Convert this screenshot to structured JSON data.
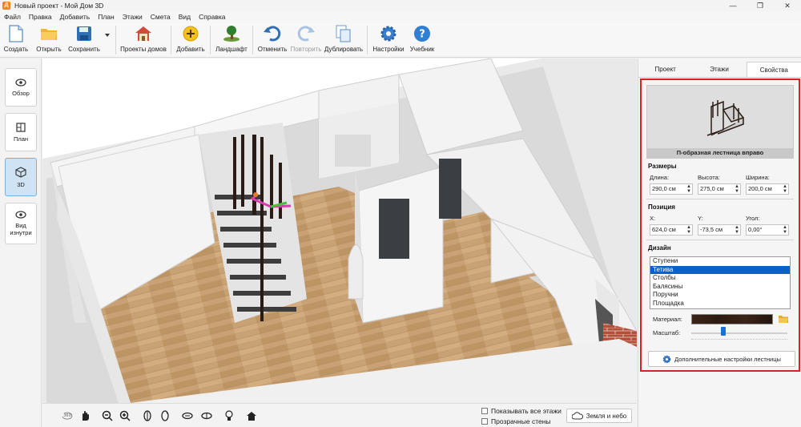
{
  "window": {
    "title": "Новый проект - Мой Дом 3D",
    "app_icon": "Д",
    "controls": [
      "—",
      "❐",
      "✕"
    ]
  },
  "menu": [
    "Файл",
    "Правка",
    "Добавить",
    "План",
    "Этажи",
    "Смета",
    "Вид",
    "Справка"
  ],
  "toolbar": {
    "create": "Создать",
    "open": "Открыть",
    "save": "Сохранить",
    "projects": "Проекты домов",
    "add": "Добавить",
    "landscape": "Ландшафт",
    "undo": "Отменить",
    "redo": "Повторить",
    "duplicate": "Дублировать",
    "settings": "Настройки",
    "tutorial": "Учебник"
  },
  "modes": {
    "overview": "Обзор",
    "plan": "План",
    "view3d": "3D",
    "inside": "Вид изнутри"
  },
  "bottom": {
    "show_floors": "Показывать все этажи",
    "transparent_walls": "Прозрачные стены",
    "ground_sky": "Земля и небо",
    "rotate360": "360"
  },
  "panel": {
    "tabs": [
      "Проект",
      "Этажи",
      "Свойства"
    ],
    "active_tab": "Свойства",
    "preview_caption": "П-образная лестница вправо",
    "sizes": {
      "heading": "Размеры",
      "length_label": "Длина:",
      "length": "290,0 см",
      "height_label": "Высота:",
      "height": "275,0 см",
      "width_label": "Ширина:",
      "width": "200,0 см"
    },
    "position": {
      "heading": "Позиция",
      "x_label": "X:",
      "x": "624,0 см",
      "y_label": "Y:",
      "y": "-73,5 см",
      "angle_label": "Угол:",
      "angle": "0,00°"
    },
    "design": {
      "heading": "Дизайн",
      "items": [
        "Ступени",
        "Тетива",
        "Столбы",
        "Балясины",
        "Поручни",
        "Площадка"
      ],
      "selected_index": 1,
      "material_label": "Материал:",
      "scale_label": "Масштаб:",
      "scale_fraction": 0.33
    },
    "more_button": "Дополнительные настройки лестницы"
  },
  "colors": {
    "accent": "#0a62c9",
    "highlight_border": "#e02020",
    "floor": "#c9a57a"
  }
}
